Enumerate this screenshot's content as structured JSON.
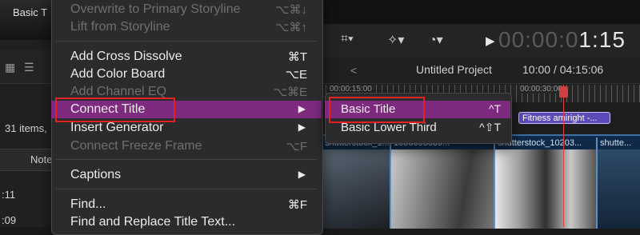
{
  "background": {
    "thumbnail_label": "Basic T",
    "items_count": "31 items,",
    "column_header": "Note",
    "row_values": [
      ":11",
      ":11",
      ":09"
    ],
    "project_name": "Untitled Project",
    "project_duration": "10:00 / 04:15:06",
    "timecode_dim": "00:00:0",
    "timecode_bright": "1:15",
    "ruler_labels": [
      "00:00:15:00",
      "00:00:30:00"
    ],
    "title_clip_label": "Fitness amiright -...",
    "clips": [
      "shutterstock_1...",
      "1056095539...",
      "shutterstock_10203...",
      "shutte..."
    ]
  },
  "context_menu": {
    "items": [
      {
        "label": "Overwrite to Primary Storyline",
        "shortcut": "⌥⌘↓",
        "enabled": false
      },
      {
        "label": "Lift from Storyline",
        "shortcut": "⌥⌘↑",
        "enabled": false
      },
      {
        "label": "Add Cross Dissolve",
        "shortcut": "⌘T",
        "enabled": true
      },
      {
        "label": "Add Color Board",
        "shortcut": "⌥E",
        "enabled": true
      },
      {
        "label": "Add Channel EQ",
        "shortcut": "⌥⌘E",
        "enabled": false
      },
      {
        "label": "Connect Title",
        "shortcut": "▶",
        "enabled": true,
        "highlighted": true
      },
      {
        "label": "Insert Generator",
        "shortcut": "▶",
        "enabled": true
      },
      {
        "label": "Connect Freeze Frame",
        "shortcut": "⌥F",
        "enabled": false
      },
      {
        "label": "Captions",
        "shortcut": "▶",
        "enabled": true
      },
      {
        "label": "Find...",
        "shortcut": "⌘F",
        "enabled": true
      },
      {
        "label": "Find and Replace Title Text...",
        "shortcut": "",
        "enabled": true
      }
    ]
  },
  "submenu": {
    "items": [
      {
        "label": "Basic Title",
        "shortcut": "^T",
        "highlighted": true
      },
      {
        "label": "Basic Lower Third",
        "shortcut": "^⇧T"
      }
    ]
  },
  "colors": {
    "highlight": "#7d2a7f",
    "annotation_red": "#e02222",
    "title_clip": "#5e4ab8"
  }
}
